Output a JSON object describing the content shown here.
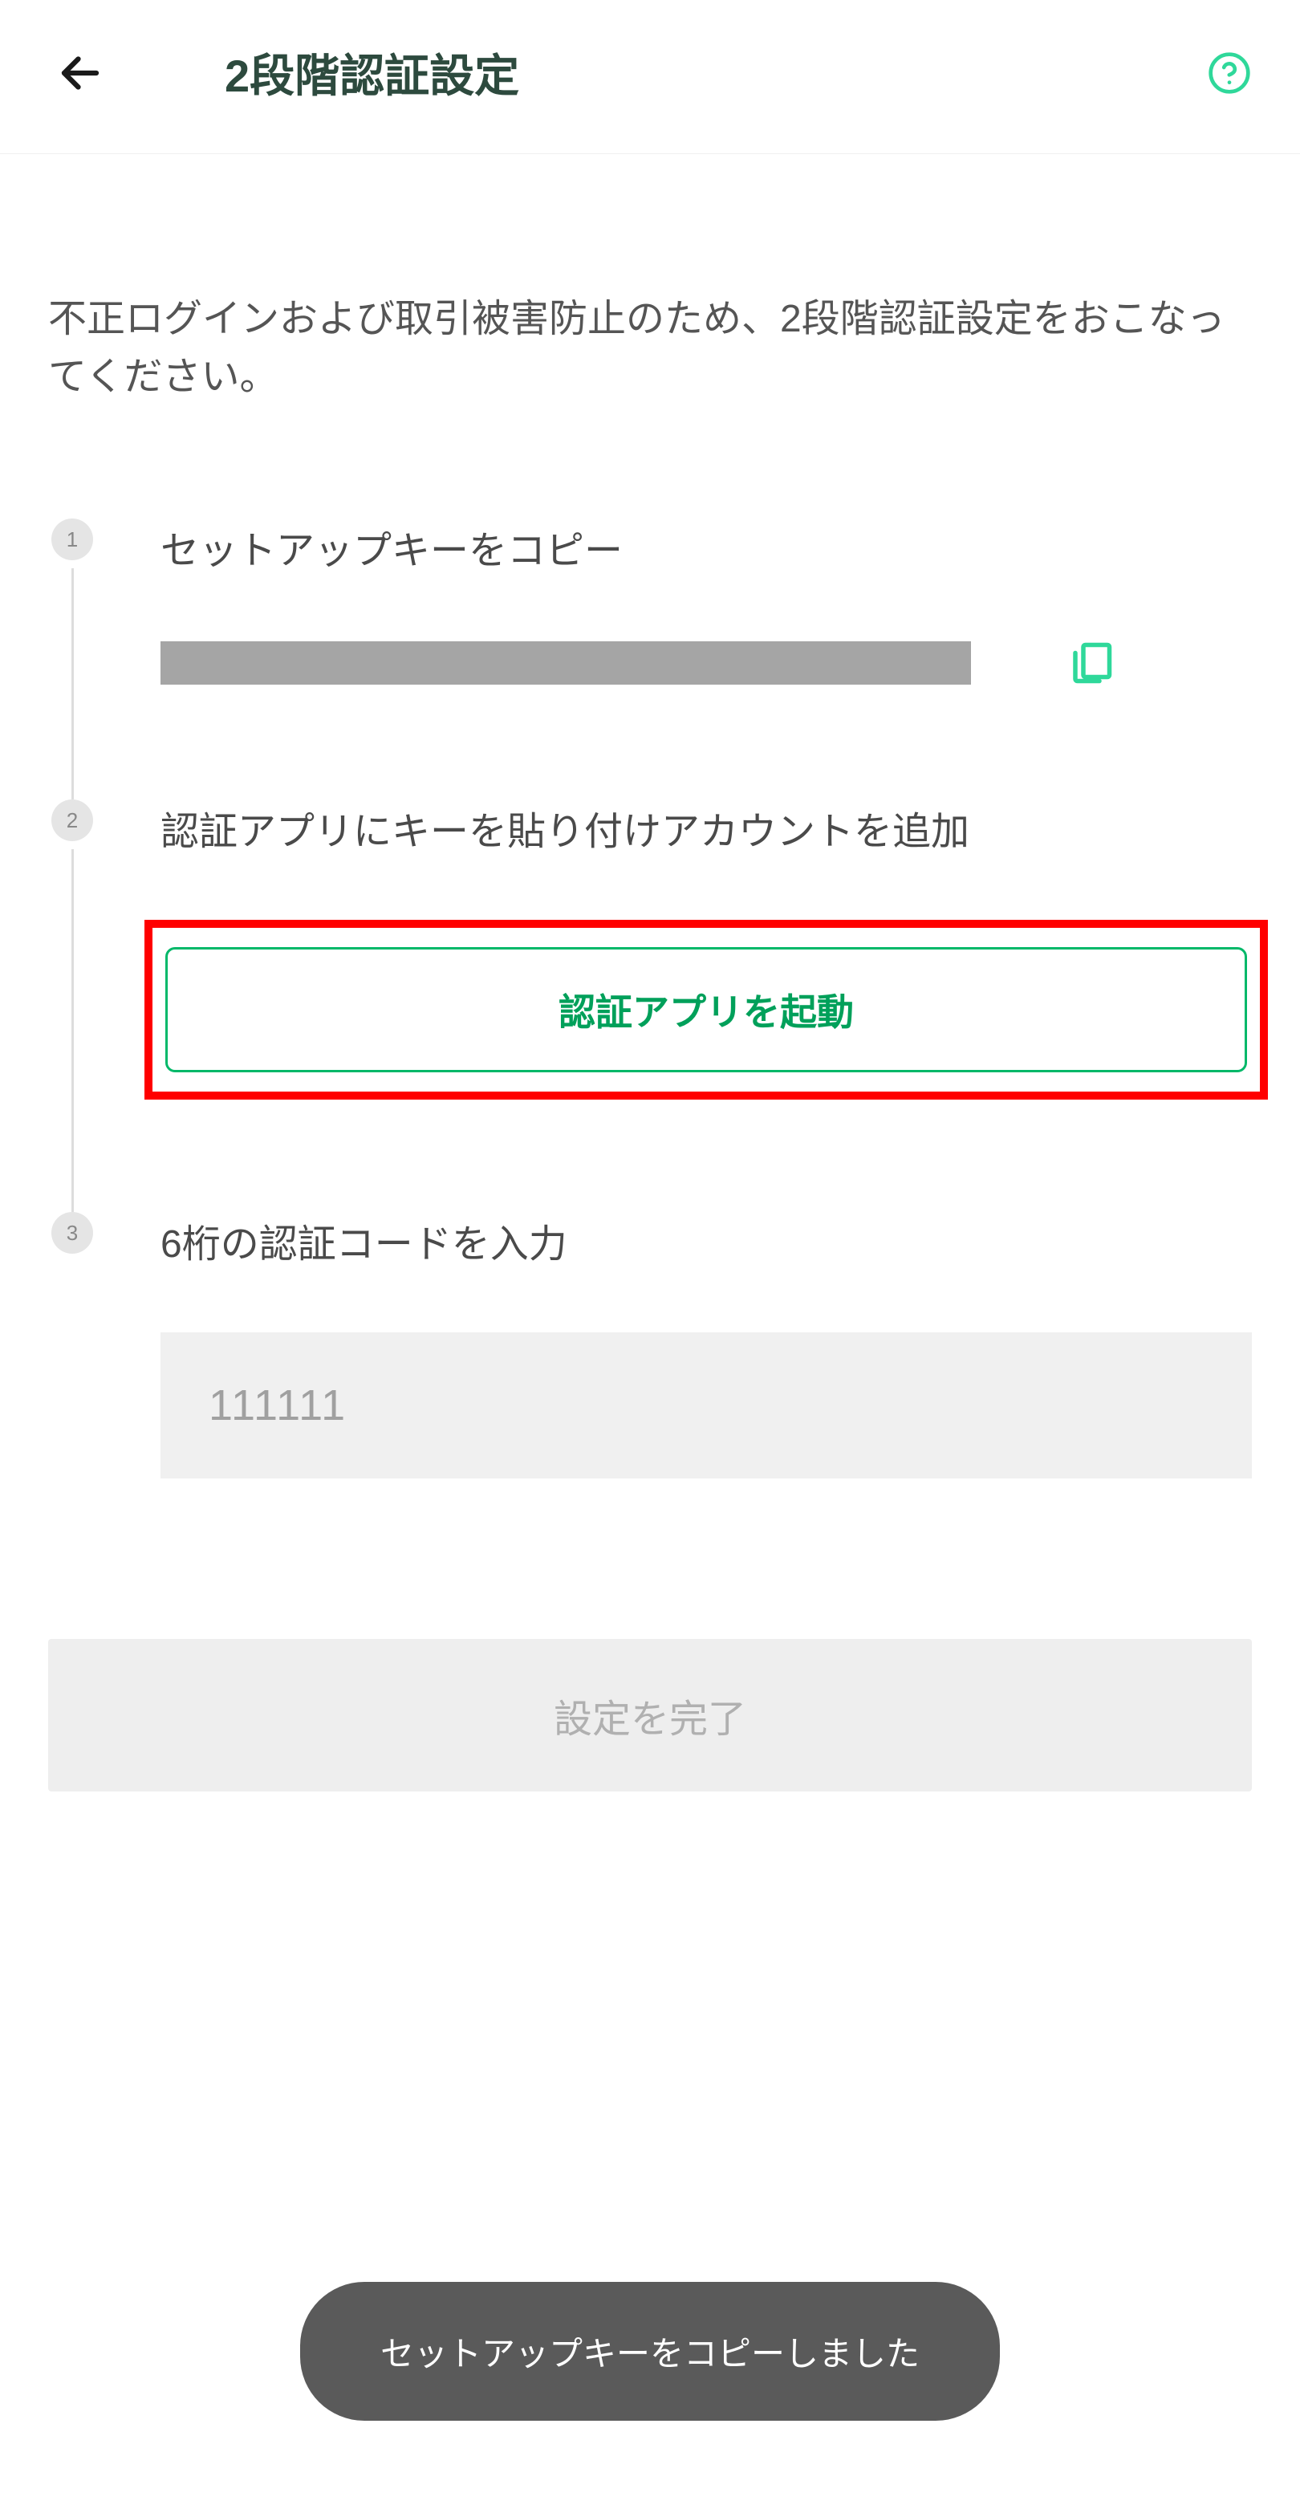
{
  "header": {
    "title": "2段階認証設定"
  },
  "description": "不正ログインおよび取引被害防止のため、2段階認証設定をおこなってください。",
  "steps": {
    "step1": {
      "number": "1",
      "title": "セットアップキーをコピー"
    },
    "step2": {
      "number": "2",
      "title": "認証アプリにキーを貼り付けアカウントを追加",
      "button_label": "認証アプリを起動"
    },
    "step3": {
      "number": "3",
      "title": "6桁の認証コードを入力",
      "placeholder": "111111"
    }
  },
  "complete_button_label": "設定を完了",
  "toast_message": "セットアップキーをコピーしました"
}
